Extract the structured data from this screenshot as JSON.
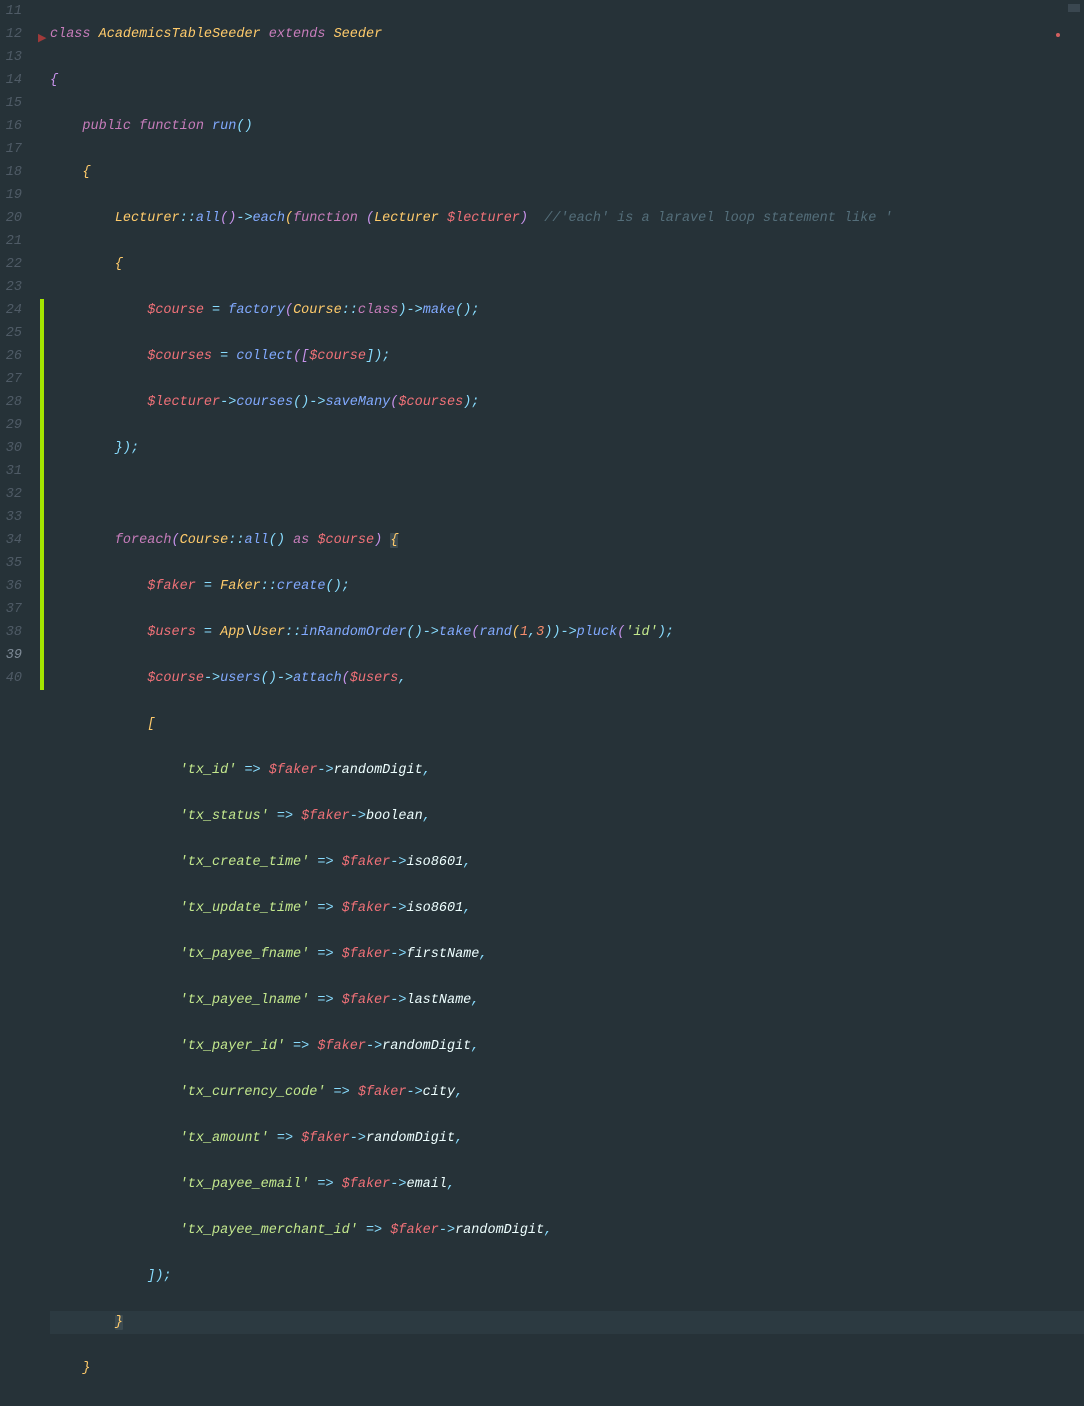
{
  "lines": {
    "start": 11,
    "end": 40,
    "current": 39,
    "modified": [
      24,
      25,
      26,
      27,
      28,
      29,
      30,
      31,
      32,
      33,
      34,
      35,
      36,
      37,
      38,
      39,
      40
    ]
  },
  "code": {
    "l11_a": "class",
    "l11_b": " AcademicsTableSeeder ",
    "l11_c": "extends",
    "l11_d": " Seeder",
    "l12": "{",
    "l13_a": "    ",
    "l13_b": "public",
    "l13_c": " ",
    "l13_d": "function",
    "l13_e": " ",
    "l13_f": "run",
    "l13_g": "()",
    "l14": "    {",
    "l15_a": "        ",
    "l15_b": "Lecturer",
    "l15_c": "::",
    "l15_d": "all",
    "l15_e": "()",
    "l15_f": "->",
    "l15_g": "each",
    "l15_h": "(",
    "l15_i": "function",
    "l15_j": " (",
    "l15_k": "Lecturer ",
    "l15_l": "$lecturer",
    "l15_m": ")  ",
    "l15_n": "//'each' is a laravel loop statement like '",
    "l16": "        {",
    "l17_a": "            ",
    "l17_b": "$course",
    "l17_c": " = ",
    "l17_d": "factory",
    "l17_e": "(",
    "l17_f": "Course",
    "l17_g": "::",
    "l17_h": "class",
    "l17_i": ")->",
    "l17_j": "make",
    "l17_k": "();",
    "l18_a": "            ",
    "l18_b": "$courses",
    "l18_c": " = ",
    "l18_d": "collect",
    "l18_e": "([",
    "l18_f": "$course",
    "l18_g": "]);",
    "l19_a": "            ",
    "l19_b": "$lecturer",
    "l19_c": "->",
    "l19_d": "courses",
    "l19_e": "()->",
    "l19_f": "saveMany",
    "l19_g": "(",
    "l19_h": "$courses",
    "l19_i": ");",
    "l20": "        });",
    "l21": "",
    "l22_a": "        ",
    "l22_b": "foreach",
    "l22_c": "(",
    "l22_d": "Course",
    "l22_e": "::",
    "l22_f": "all",
    "l22_g": "() ",
    "l22_h": "as",
    "l22_i": " ",
    "l22_j": "$course",
    "l22_k": ") ",
    "l22_l": "{",
    "l23_a": "            ",
    "l23_b": "$faker",
    "l23_c": " = ",
    "l23_d": "Faker",
    "l23_e": "::",
    "l23_f": "create",
    "l23_g": "();",
    "l24_a": "            ",
    "l24_b": "$users",
    "l24_c": " = ",
    "l24_d": "App",
    "l24_e": "\\",
    "l24_f": "User",
    "l24_g": "::",
    "l24_h": "inRandomOrder",
    "l24_i": "()->",
    "l24_j": "take",
    "l24_k": "(",
    "l24_l": "rand",
    "l24_m": "(",
    "l24_n": "1",
    "l24_o": ",",
    "l24_p": "3",
    "l24_q": "))->",
    "l24_r": "pluck",
    "l24_s": "(",
    "l24_t": "'id'",
    "l24_u": ");",
    "l25_a": "            ",
    "l25_b": "$course",
    "l25_c": "->",
    "l25_d": "users",
    "l25_e": "()->",
    "l25_f": "attach",
    "l25_g": "(",
    "l25_h": "$users",
    "l25_i": ",",
    "l26": "            [",
    "l27_a": "                ",
    "l27_b": "'tx_id'",
    "l27_c": " => ",
    "l27_d": "$faker",
    "l27_e": "->",
    "l27_f": "randomDigit",
    "l27_g": ",",
    "l28_a": "                ",
    "l28_b": "'tx_status'",
    "l28_c": " => ",
    "l28_d": "$faker",
    "l28_e": "->",
    "l28_f": "boolean",
    "l28_g": ",",
    "l29_a": "                ",
    "l29_b": "'tx_create_time'",
    "l29_c": " => ",
    "l29_d": "$faker",
    "l29_e": "->",
    "l29_f": "iso8601",
    "l29_g": ",",
    "l30_a": "                ",
    "l30_b": "'tx_update_time'",
    "l30_c": " => ",
    "l30_d": "$faker",
    "l30_e": "->",
    "l30_f": "iso8601",
    "l30_g": ",",
    "l31_a": "                ",
    "l31_b": "'tx_payee_fname'",
    "l31_c": " => ",
    "l31_d": "$faker",
    "l31_e": "->",
    "l31_f": "firstName",
    "l31_g": ",",
    "l32_a": "                ",
    "l32_b": "'tx_payee_lname'",
    "l32_c": " => ",
    "l32_d": "$faker",
    "l32_e": "->",
    "l32_f": "lastName",
    "l32_g": ",",
    "l33_a": "                ",
    "l33_b": "'tx_payer_id'",
    "l33_c": " => ",
    "l33_d": "$faker",
    "l33_e": "->",
    "l33_f": "randomDigit",
    "l33_g": ",",
    "l34_a": "                ",
    "l34_b": "'tx_currency_code'",
    "l34_c": " => ",
    "l34_d": "$faker",
    "l34_e": "->",
    "l34_f": "city",
    "l34_g": ",",
    "l35_a": "                ",
    "l35_b": "'tx_amount'",
    "l35_c": " => ",
    "l35_d": "$faker",
    "l35_e": "->",
    "l35_f": "randomDigit",
    "l35_g": ",",
    "l36_a": "                ",
    "l36_b": "'tx_payee_email'",
    "l36_c": " => ",
    "l36_d": "$faker",
    "l36_e": "->",
    "l36_f": "email",
    "l36_g": ",",
    "l37_a": "                ",
    "l37_b": "'tx_payee_merchant_id'",
    "l37_c": " => ",
    "l37_d": "$faker",
    "l37_e": "->",
    "l37_f": "randomDigit",
    "l37_g": ",",
    "l38": "            ]);",
    "l39_a": "        ",
    "l39_b": "}",
    "l40": "    }"
  }
}
